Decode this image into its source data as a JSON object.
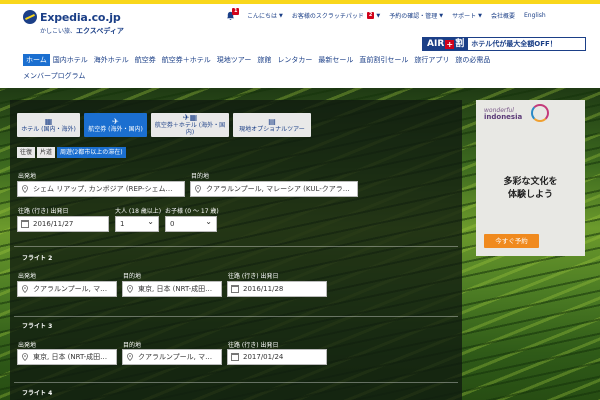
{
  "header": {
    "logo_text": "Expedia.co.jp",
    "tagline_prefix": "かしこい旅、",
    "tagline_brand": "エクスペディア",
    "bell_badge": "1",
    "nav": [
      {
        "label": "こんにちは",
        "badge": ""
      },
      {
        "label": "お客様のスクラッチパッド",
        "badge": "2"
      },
      {
        "label": "予約の確認・管理",
        "badge": ""
      },
      {
        "label": "サポート",
        "badge": ""
      },
      {
        "label": "会社概要",
        "badge": ""
      },
      {
        "label": "English",
        "badge": ""
      }
    ]
  },
  "ad": {
    "air": "AIR",
    "plus": "+",
    "wari": "割",
    "text": "ホテル代が最大全額OFF！"
  },
  "main_nav": [
    "ホーム",
    "国内ホテル",
    "海外ホテル",
    "航空券",
    "航空券＋ホテル",
    "現地ツアー",
    "旅館",
    "レンタカー",
    "最新セール",
    "直前割引セール",
    "旅行アプリ",
    "旅の必需品"
  ],
  "sub_nav": "メンバープログラム",
  "search": {
    "tabs": [
      {
        "label": "ホテル (国内・海外)",
        "icon": "hotel-icon",
        "active": false
      },
      {
        "label": "航空券 (海外・国内)",
        "icon": "plane-icon",
        "active": true
      },
      {
        "label": "航空券＋ホテル (海外・国内)",
        "icon": "plane-hotel-icon",
        "active": false
      },
      {
        "label": "現地オプショナルツアー",
        "icon": "ticket-icon",
        "active": false
      }
    ],
    "trip_types": [
      "往復",
      "片道",
      "周遊(2都市以上の滞在)"
    ],
    "labels": {
      "origin": "出発地",
      "destination": "目的地",
      "depart_date": "往路 (行き) 出発日",
      "adults": "大人 (18 歳以上)",
      "children": "お子様 (0 ～ 17 歳)"
    },
    "flight1": {
      "origin": "シェム リアップ, カンボジア (REP-シェム…",
      "destination": "クアラルンプール, マレーシア (KUL-クアラ…",
      "date": "2016/11/27",
      "adults": "1",
      "children": "0"
    },
    "flight2": {
      "title": "フライト 2",
      "origin": "クアラルンプール, マ…",
      "destination": "東京, 日本 (NRT-成田…",
      "date": "2016/11/28"
    },
    "flight3": {
      "title": "フライト 3",
      "origin": "東京, 日本 (NRT-成田…",
      "destination": "クアラルンプール, マ…",
      "date": "2017/01/24"
    },
    "flight4": {
      "title": "フライト 4"
    }
  },
  "promo": {
    "brand_small": "wonderful",
    "brand": "indonesia",
    "line1": "多彩な文化を",
    "line2": "体験しよう",
    "button": "今すぐ予約"
  },
  "colors": {
    "brand_blue": "#1b3f87",
    "active_blue": "#1b6fd0",
    "accent_yellow": "#f9d71c",
    "badge_red": "#d0021b",
    "promo_orange": "#f08a1e"
  }
}
